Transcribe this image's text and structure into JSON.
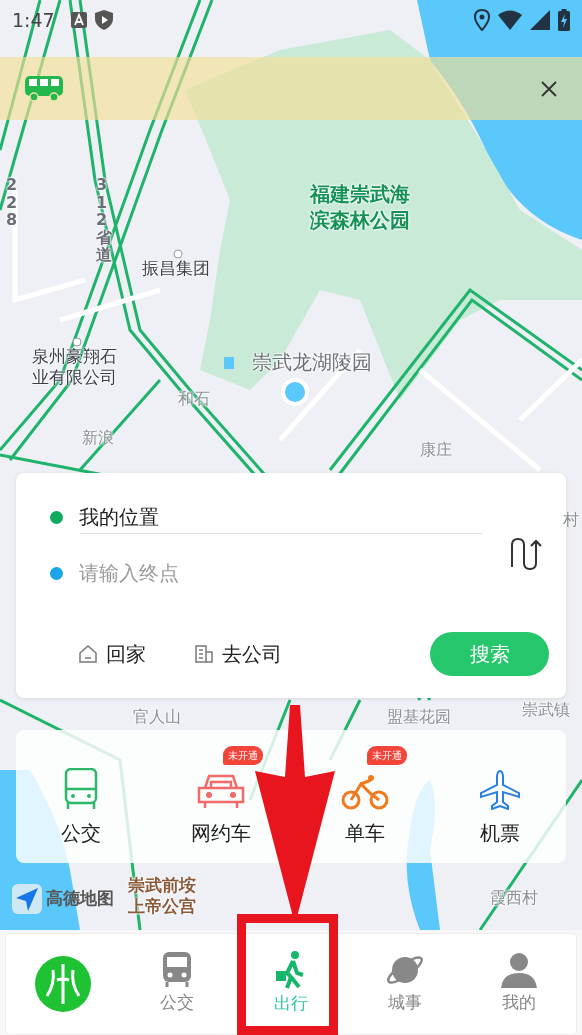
{
  "status_bar": {
    "time": "1:47"
  },
  "map": {
    "labels": [
      {
        "text": "福建崇武海",
        "kind": "park"
      },
      {
        "text": "滨森林公园",
        "kind": "park"
      },
      {
        "text": "振昌集团",
        "kind": "poi"
      },
      {
        "text": "泉州豪翔石",
        "kind": "poi"
      },
      {
        "text": "业有限公司",
        "kind": "poi"
      },
      {
        "text": "崇武龙湖陵园",
        "kind": "area"
      },
      {
        "text": "和石",
        "kind": "place"
      },
      {
        "text": "新浪",
        "kind": "place"
      },
      {
        "text": "康庄",
        "kind": "place"
      },
      {
        "text": "村",
        "kind": "place"
      },
      {
        "text": "官人山",
        "kind": "place"
      },
      {
        "text": "盟基花园",
        "kind": "place"
      },
      {
        "text": "崇武镇",
        "kind": "place"
      },
      {
        "text": "崇武前垵",
        "kind": "temple"
      },
      {
        "text": "上帝公宫",
        "kind": "temple"
      },
      {
        "text": "霞西村",
        "kind": "place"
      },
      {
        "text": "228",
        "kind": "road"
      },
      {
        "text": "312省道",
        "kind": "road"
      }
    ],
    "logo": "高德地图"
  },
  "route": {
    "origin": "我的位置",
    "destination_placeholder": "请输入终点",
    "shortcuts": [
      {
        "label": "回家",
        "kind": "home"
      },
      {
        "label": "去公司",
        "kind": "office"
      }
    ],
    "search_button": "搜索"
  },
  "services": [
    {
      "label": "公交",
      "kind": "bus"
    },
    {
      "label": "网约车",
      "kind": "car",
      "badge": "未开通"
    },
    {
      "label": "单车",
      "kind": "bike",
      "badge": "未开通"
    },
    {
      "label": "机票",
      "kind": "plane"
    }
  ],
  "tabs": [
    {
      "kind": "logo",
      "selected": false
    },
    {
      "kind": "bus",
      "label": "公交",
      "selected": false
    },
    {
      "kind": "walk",
      "label": "出行",
      "selected": true
    },
    {
      "kind": "planet",
      "label": "城事",
      "selected": false
    },
    {
      "kind": "person",
      "label": "我的",
      "selected": false
    }
  ]
}
